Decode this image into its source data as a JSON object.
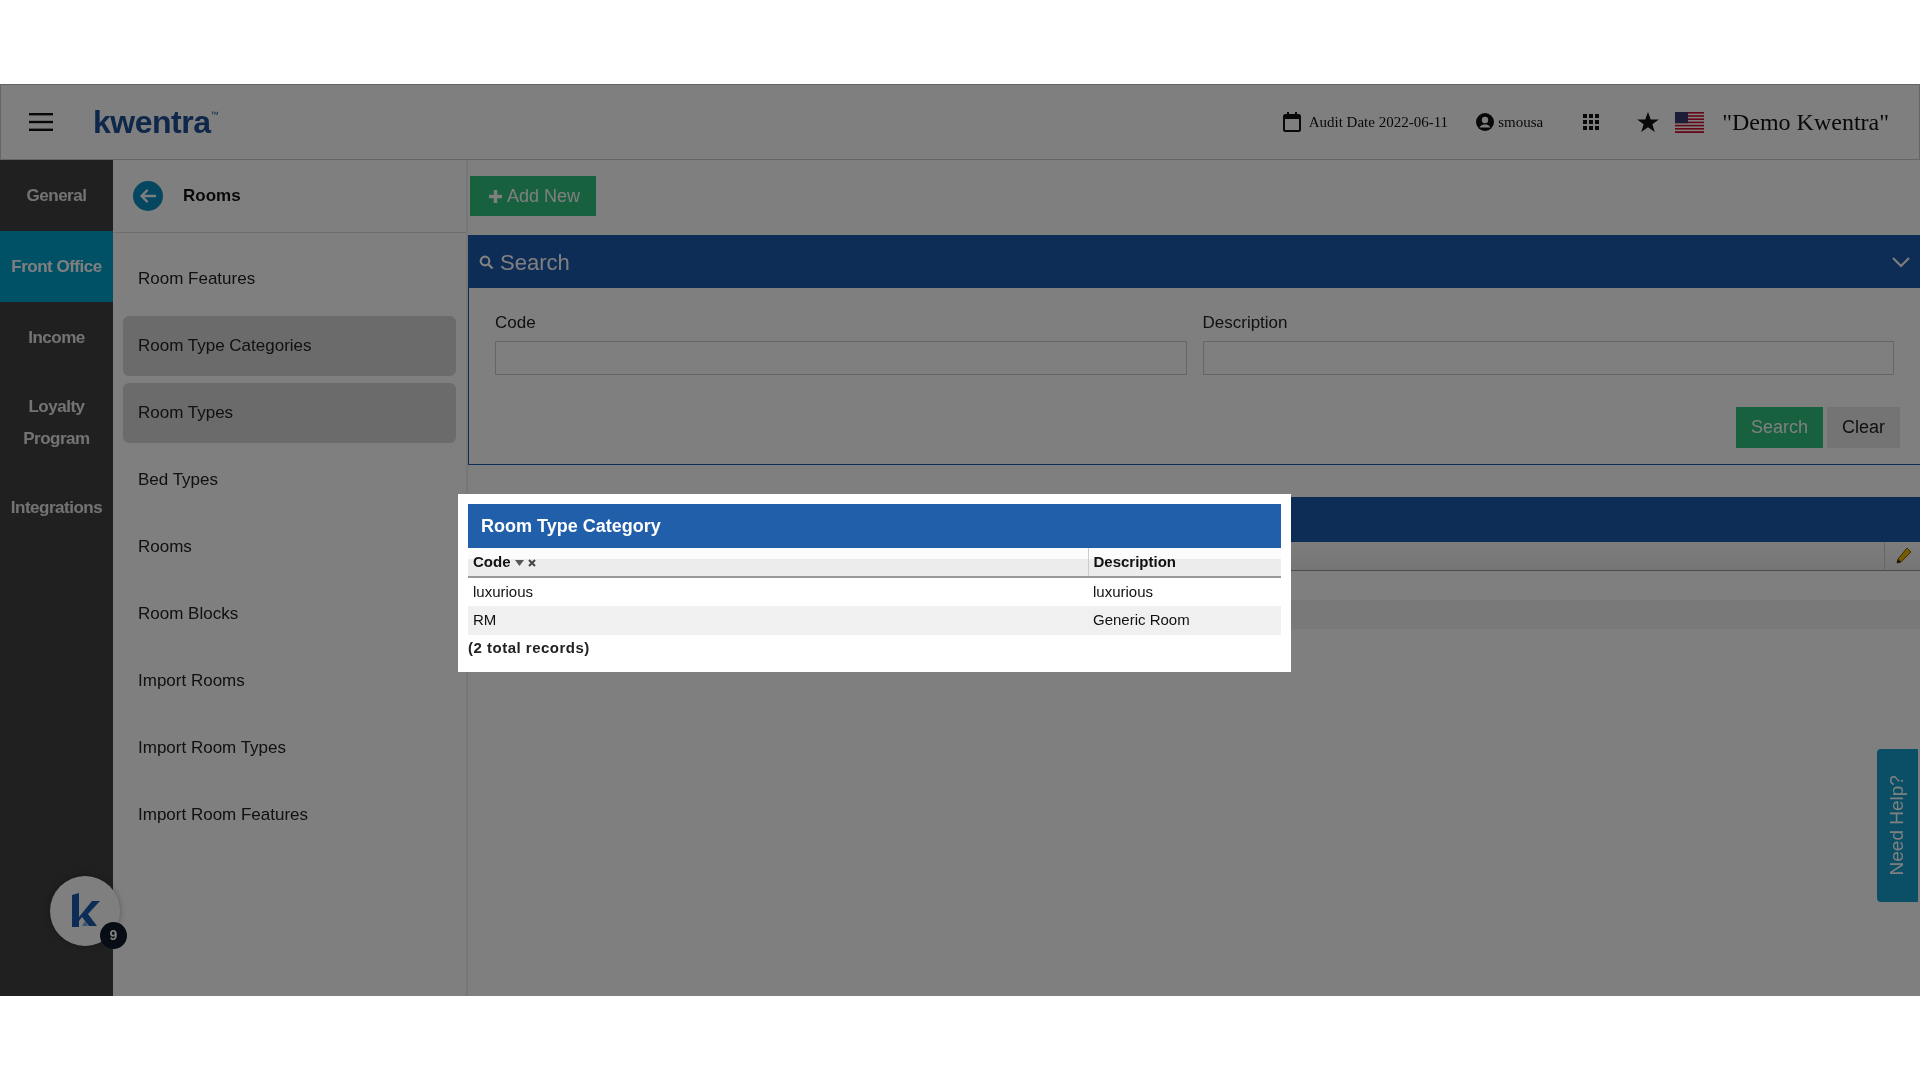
{
  "topbar": {
    "logo": "kwentra$^{™}$",
    "audit_date": "Audit Date 2022-06-11",
    "user": "smousa",
    "company": "\"Demo Kwentra\""
  },
  "rail": [
    {
      "label": "General",
      "selected": false
    },
    {
      "label": "Front Office",
      "selected": true
    },
    {
      "label": "Income",
      "selected": false
    },
    {
      "label": "Loyalty Program",
      "selected": false
    },
    {
      "label": "Integrations",
      "selected": false
    }
  ],
  "submenu": {
    "title": "Rooms",
    "items": [
      {
        "label": "Room Features",
        "selected": false
      },
      {
        "label": "Room Type Categories",
        "selected": true
      },
      {
        "label": "Room Types",
        "selected": true
      },
      {
        "label": "Bed Types",
        "selected": false
      },
      {
        "label": "Rooms",
        "selected": false
      },
      {
        "label": "Room Blocks",
        "selected": false
      },
      {
        "label": "Import Rooms",
        "selected": false
      },
      {
        "label": "Import Room Types",
        "selected": false
      },
      {
        "label": "Import Room Features",
        "selected": false
      }
    ]
  },
  "add_button": "Add New",
  "search_panel": {
    "title": "Search",
    "fields": [
      {
        "label": "Code"
      },
      {
        "label": "Description"
      }
    ],
    "buttons": [
      {
        "label": "Search",
        "kind": "primary"
      },
      {
        "label": "Clear",
        "kind": "secondary"
      }
    ]
  },
  "modal": {
    "title": "Room Type Category",
    "columns": [
      {
        "label": "Code",
        "sorted": true
      },
      {
        "label": "Description",
        "sorted": false
      }
    ],
    "rows": [
      [
        "luxurious",
        "luxurious"
      ],
      [
        "RM",
        "Generic Room"
      ]
    ],
    "footer": "(2 total records)"
  },
  "help_tab": "Need Help?",
  "launcher_badge": "9"
}
